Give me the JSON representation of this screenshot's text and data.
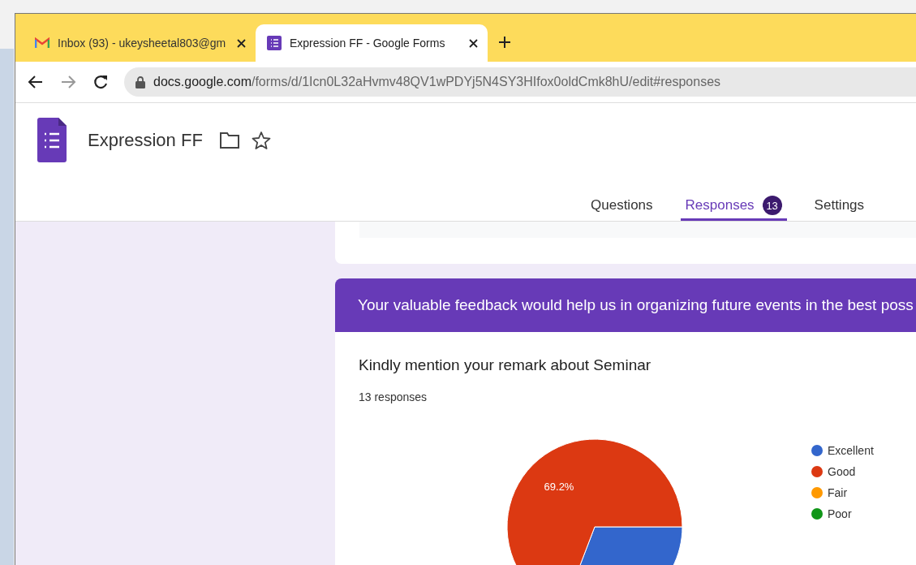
{
  "browser": {
    "tabs": [
      {
        "kind": "mail",
        "title": "Inbox (93) - ukeysheetal803@gm",
        "selected": false
      },
      {
        "kind": "form",
        "title": "Expression FF - Google Forms",
        "selected": true
      }
    ],
    "address": {
      "host": "docs.google.com",
      "path": "/forms/d/1Icn0L32aHvmv48QV1wPDYj5N4SY3HIfox0oldCmk8hU/edit#responses"
    }
  },
  "form": {
    "title": "Expression FF",
    "tabs": [
      {
        "label": "Questions",
        "selected": false
      },
      {
        "label": "Responses",
        "selected": true,
        "badge": "13"
      },
      {
        "label": "Settings",
        "selected": false
      }
    ]
  },
  "section_header": "Your valuable feedback would help us in organizing future events in the best poss",
  "question": {
    "title": "Kindly mention your remark about Seminar",
    "count": "13 responses",
    "chart_data": {
      "type": "pie",
      "categories": [
        "Excellent",
        "Good",
        "Fair",
        "Poor"
      ],
      "values": [
        30.8,
        69.2,
        0,
        0
      ],
      "legend": true,
      "colors": [
        "#3366cc",
        "#dc3912",
        "#ff9900",
        "#109618"
      ],
      "value_labels": [
        null,
        "69.2%",
        null,
        null
      ]
    }
  }
}
